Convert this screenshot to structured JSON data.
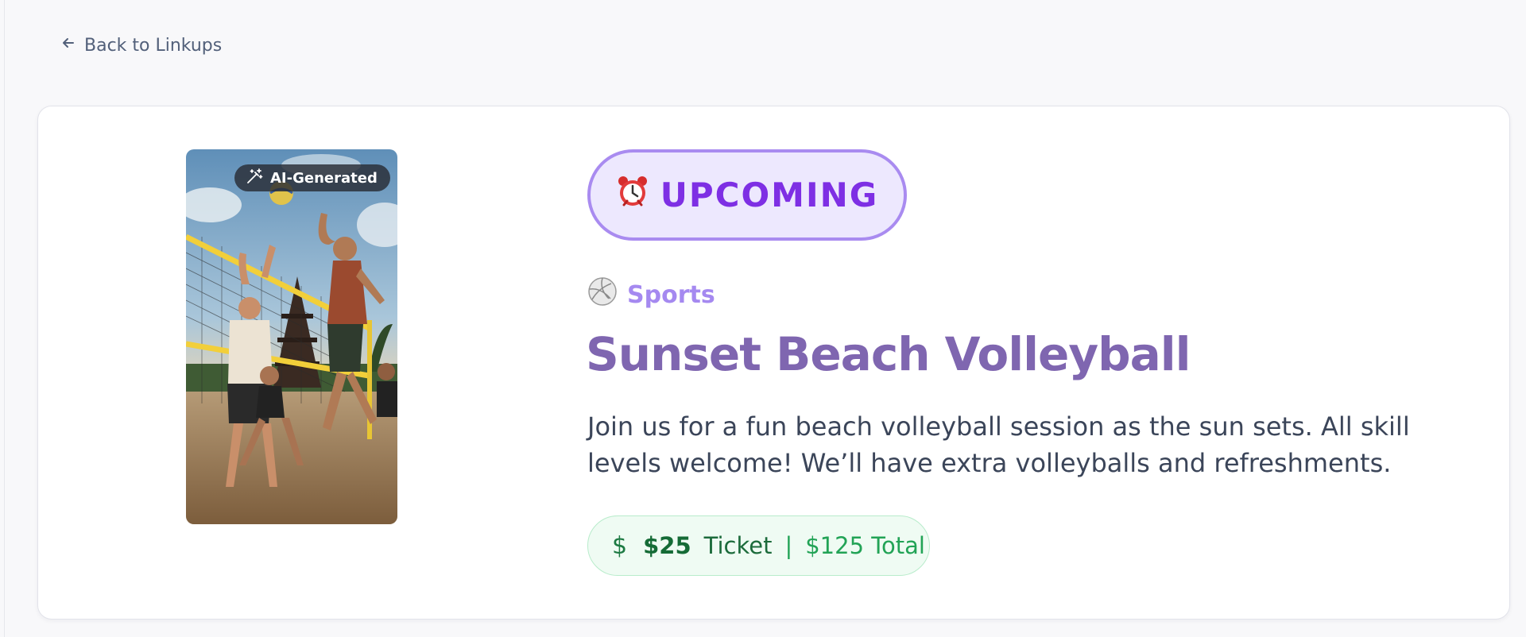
{
  "nav": {
    "back_label": "Back to Linkups",
    "back_icon": "arrow-left-icon"
  },
  "event": {
    "image_badge": "AI-Generated",
    "image_badge_icon": "magic-wand-icon",
    "status": "UPCOMING",
    "status_icon": "alarm-clock-icon",
    "category": "Sports",
    "category_icon": "volleyball-icon",
    "title": "Sunset Beach Volleyball",
    "description": "Join us for a fun beach volleyball session as the sun sets. All skill levels welcome! We’ll have extra volleyballs and refreshments.",
    "price": {
      "icon": "dollar-icon",
      "ticket_amount": "$25",
      "ticket_label": "Ticket",
      "separator": "|",
      "total": "$125 Total"
    }
  },
  "colors": {
    "page_bg": "#f8f8fa",
    "status_text": "#7e2fe4",
    "status_bg": "#ede8fe",
    "status_border": "#a98bf0",
    "category": "#a589f0",
    "title": "#7f66b0",
    "price_green": "#22a356",
    "price_bg": "#effbf3"
  }
}
